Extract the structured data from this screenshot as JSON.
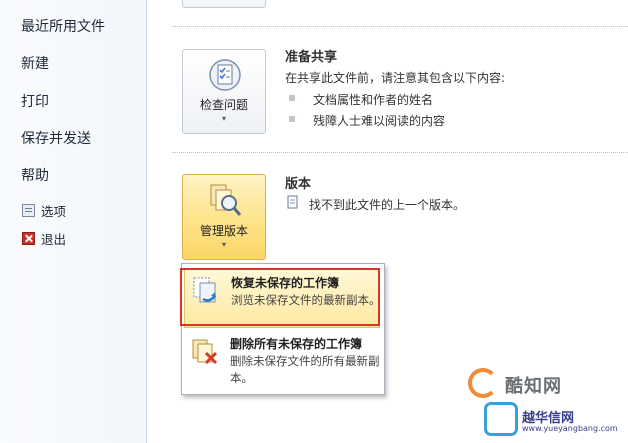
{
  "nav": {
    "recent": "最近所用文件",
    "new": "新建",
    "print": "打印",
    "save_send": "保存并发送",
    "help": "帮助",
    "options": "选项",
    "exit": "退出"
  },
  "prepare": {
    "button_label": "检查问题",
    "title": "准备共享",
    "intro": "在共享此文件前，请注意其包含以下内容:",
    "bullets": [
      "文档属性和作者的姓名",
      "残障人士难以阅读的内容"
    ]
  },
  "versions": {
    "button_label": "管理版本",
    "title": "版本",
    "note": "找不到此文件的上一个版本。"
  },
  "menu": {
    "items": [
      {
        "title": "恢复未保存的工作簿",
        "desc": "浏览未保存文件的最新副本。"
      },
      {
        "title": "删除所有未保存的工作簿",
        "desc": "删除未保存文件的所有最新副本。"
      }
    ]
  },
  "watermark": {
    "line1": "酷知网",
    "line2": "越华信网",
    "line3": "www.yueyangbang.com"
  },
  "colors": {
    "highlight": "#fde38a",
    "callout_border": "#d9342b",
    "exit_icon": "#c8332b"
  }
}
